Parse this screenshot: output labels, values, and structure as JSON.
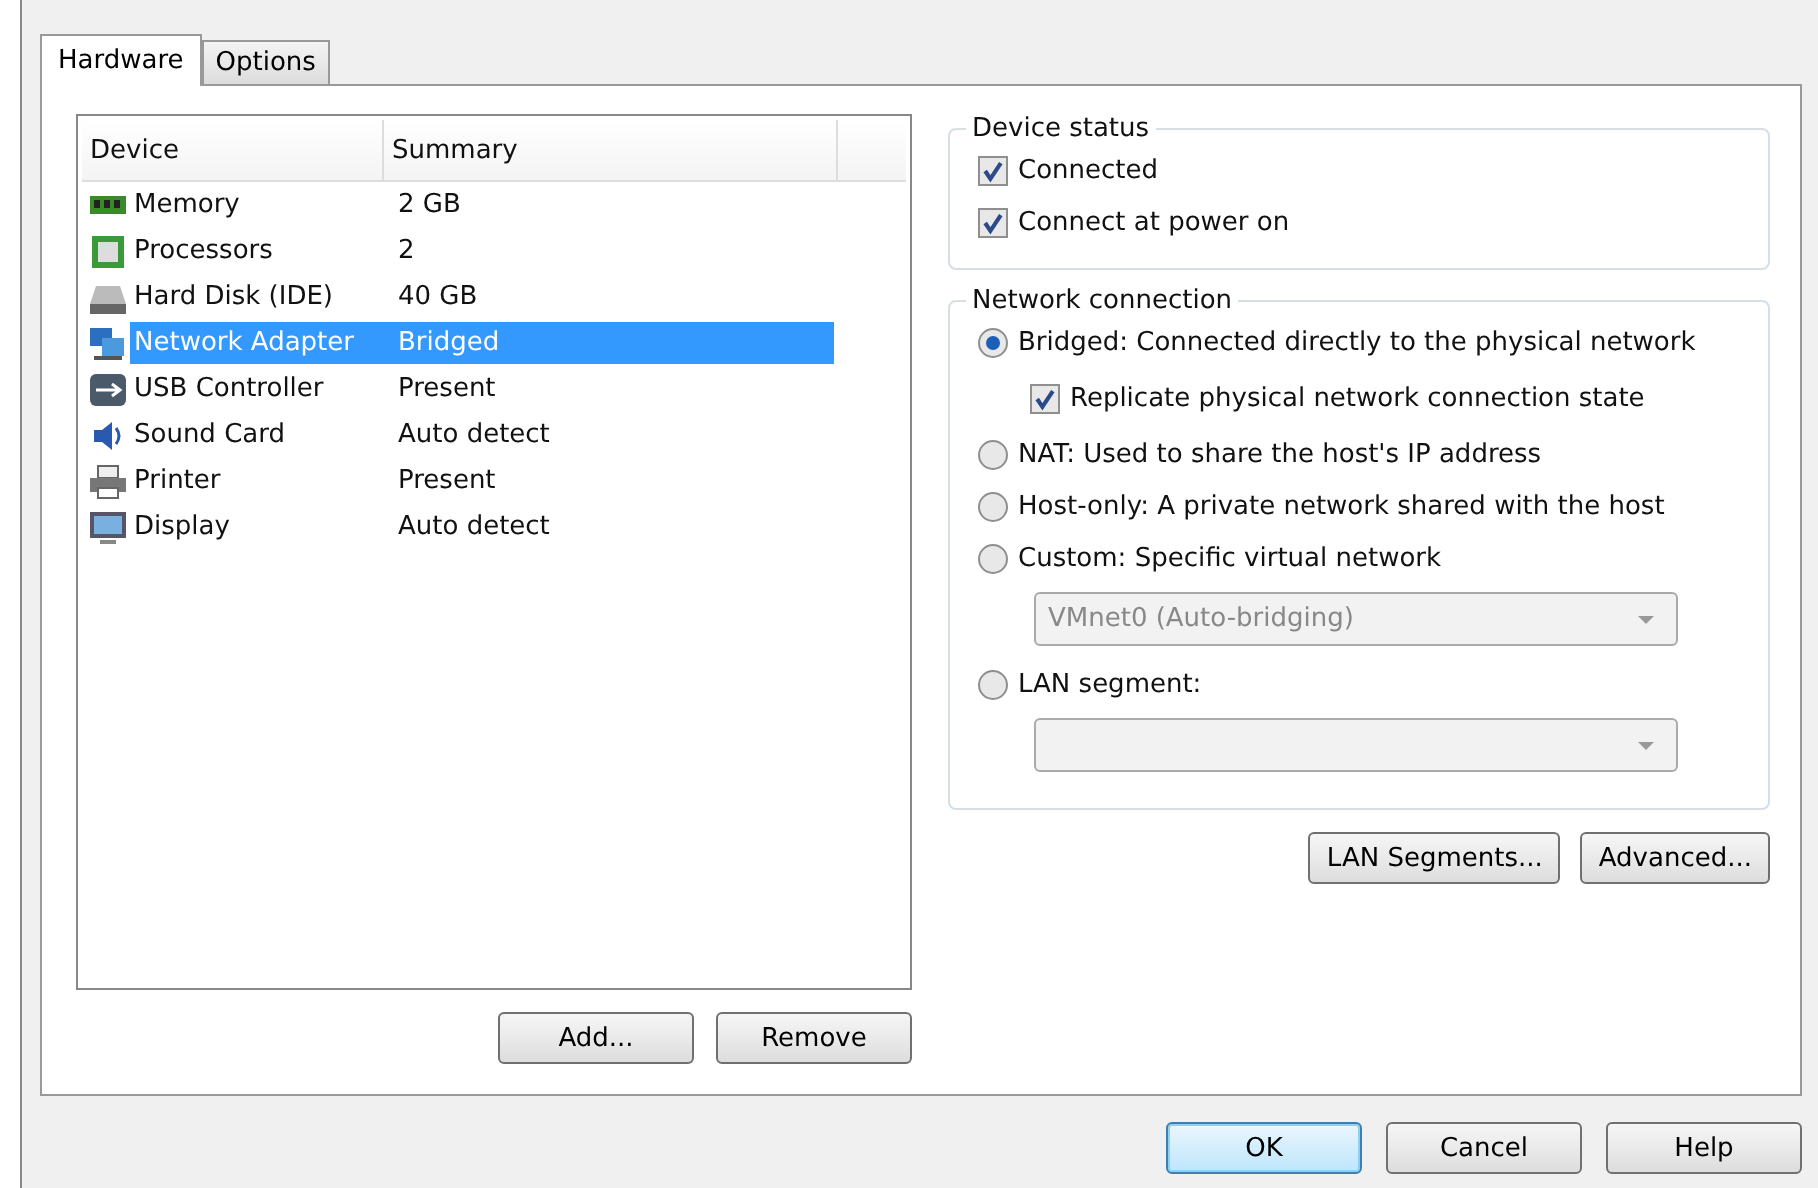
{
  "tabs": [
    {
      "label": "Hardware",
      "selected": true
    },
    {
      "label": "Options",
      "selected": false
    }
  ],
  "device_list": {
    "columns": [
      "Device",
      "Summary"
    ],
    "rows": [
      {
        "kind": "memory",
        "device": "Memory",
        "summary": "2 GB",
        "selected": false
      },
      {
        "kind": "processor",
        "device": "Processors",
        "summary": "2",
        "selected": false
      },
      {
        "kind": "disk",
        "device": "Hard Disk (IDE)",
        "summary": "40 GB",
        "selected": false
      },
      {
        "kind": "network",
        "device": "Network Adapter",
        "summary": "Bridged",
        "selected": true
      },
      {
        "kind": "usb",
        "device": "USB Controller",
        "summary": "Present",
        "selected": false
      },
      {
        "kind": "sound",
        "device": "Sound Card",
        "summary": "Auto detect",
        "selected": false
      },
      {
        "kind": "printer",
        "device": "Printer",
        "summary": "Present",
        "selected": false
      },
      {
        "kind": "display",
        "device": "Display",
        "summary": "Auto detect",
        "selected": false
      }
    ]
  },
  "list_buttons": [
    "Add...",
    "Remove"
  ],
  "device_status": {
    "title": "Device status",
    "options": [
      {
        "label": "Connected",
        "checked": true
      },
      {
        "label": "Connect at power on",
        "checked": true
      }
    ]
  },
  "network_connection": {
    "title": "Network connection",
    "items": [
      {
        "kind": "radio",
        "label": "Bridged: Connected directly to the physical network",
        "selected": true
      },
      {
        "kind": "checkbox",
        "label": "Replicate physical network connection state",
        "checked": true
      },
      {
        "kind": "radio",
        "label": "NAT: Used to share the host's IP address",
        "selected": false
      },
      {
        "kind": "radio",
        "label": "Host-only: A private network shared with the host",
        "selected": false
      },
      {
        "kind": "radio",
        "label": "Custom: Specific virtual network",
        "selected": false
      },
      {
        "kind": "dropdown",
        "value": "VMnet0 (Auto-bridging)",
        "disabled": true
      },
      {
        "kind": "radio",
        "label": "LAN segment:",
        "selected": false
      },
      {
        "kind": "dropdown",
        "disabled": true
      }
    ]
  },
  "network_buttons": [
    "LAN Segments...",
    "Advanced..."
  ],
  "dialog_buttons": [
    {
      "label": "OK",
      "default": true
    },
    {
      "label": "Cancel",
      "default": false
    },
    {
      "label": "Help",
      "default": false
    }
  ]
}
